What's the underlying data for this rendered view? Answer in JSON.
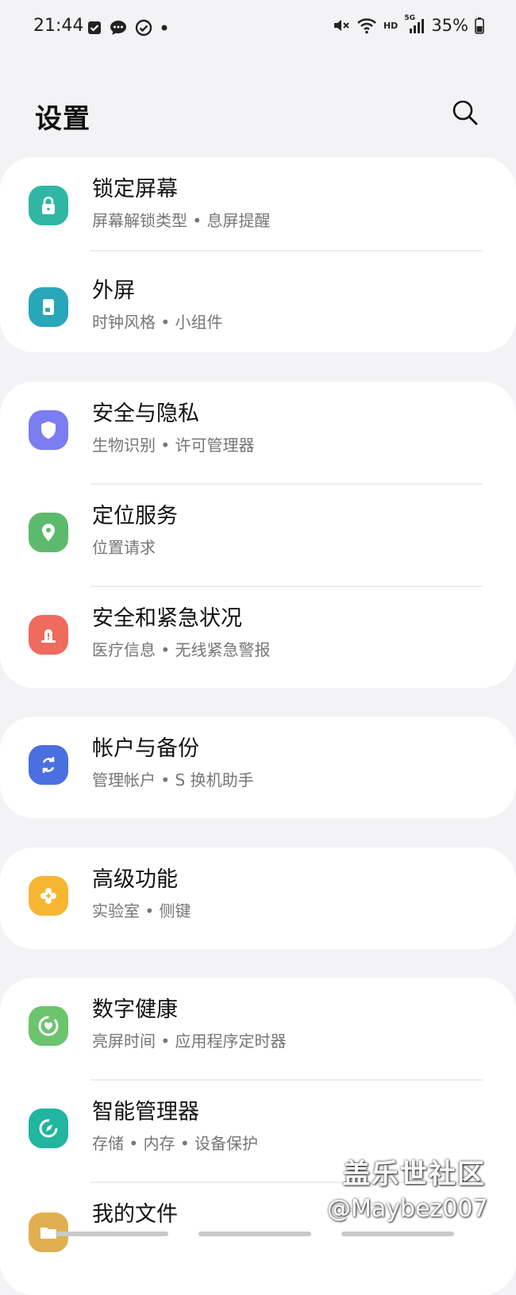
{
  "status_bar": {
    "time": "21:44",
    "network_label": "HD",
    "network_type": "5G",
    "battery": "35%"
  },
  "header": {
    "title": "设置",
    "search_icon": "search-icon"
  },
  "cards": [
    {
      "rows": [
        {
          "id": "lock-screen",
          "title": "锁定屏幕",
          "subtitle": "屏幕解锁类型 • 息屏提醒",
          "icon": "lock-icon",
          "color": "#2fb7a4"
        },
        {
          "id": "cover-screen",
          "title": "外屏",
          "subtitle": "时钟风格 • 小组件",
          "icon": "cover-screen-icon",
          "color": "#28a7b8"
        }
      ]
    },
    {
      "rows": [
        {
          "id": "security-privacy",
          "title": "安全与隐私",
          "subtitle": "生物识别 • 许可管理器",
          "icon": "shield-icon",
          "color": "#7a7ef0"
        },
        {
          "id": "location",
          "title": "定位服务",
          "subtitle": "位置请求",
          "icon": "location-pin-icon",
          "color": "#5dba6c"
        },
        {
          "id": "safety-emergency",
          "title": "安全和紧急状况",
          "subtitle": "医疗信息 • 无线紧急警报",
          "icon": "emergency-icon",
          "color": "#ee6b5e"
        }
      ]
    },
    {
      "rows": [
        {
          "id": "accounts-backup",
          "title": "帐户与备份",
          "subtitle": "管理帐户 • S 换机助手",
          "icon": "sync-icon",
          "color": "#4a6fe0"
        }
      ]
    },
    {
      "rows": [
        {
          "id": "advanced-features",
          "title": "高级功能",
          "subtitle": "实验室 • 侧键",
          "icon": "puzzle-icon",
          "color": "#f7b631"
        }
      ]
    },
    {
      "rows": [
        {
          "id": "digital-wellbeing",
          "title": "数字健康",
          "subtitle": "亮屏时间 • 应用程序定时器",
          "icon": "heart-ring-icon",
          "color": "#6cc46e"
        },
        {
          "id": "device-care",
          "title": "智能管理器",
          "subtitle": "存储 • 内存 • 设备保护",
          "icon": "device-care-icon",
          "color": "#22b5a0"
        },
        {
          "id": "my-files",
          "title": "我的文件",
          "subtitle": "",
          "icon": "folder-icon",
          "color": "#e0b050"
        }
      ]
    }
  ],
  "watermark": {
    "line1": "盖乐世社区",
    "line2": "@Maybez007"
  }
}
